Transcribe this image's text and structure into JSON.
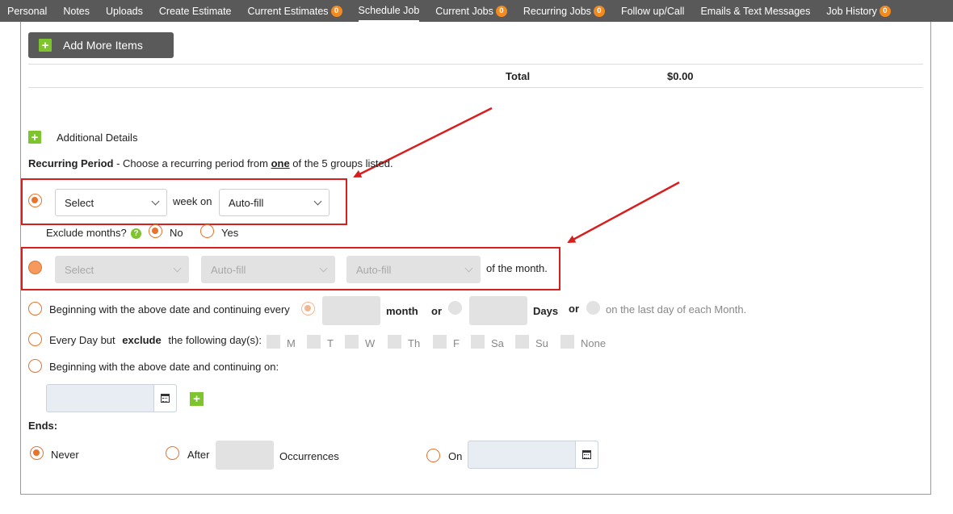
{
  "nav": {
    "tabs": [
      {
        "label": "Personal"
      },
      {
        "label": "Notes"
      },
      {
        "label": "Uploads"
      },
      {
        "label": "Create Estimate"
      },
      {
        "label": "Current Estimates",
        "count": "0"
      },
      {
        "label": "Schedule Job"
      },
      {
        "label": "Current Jobs",
        "count": "0"
      },
      {
        "label": "Recurring Jobs",
        "count": "0"
      },
      {
        "label": "Follow up/Call"
      },
      {
        "label": "Emails & Text Messages"
      },
      {
        "label": "Job History",
        "count": "0"
      }
    ],
    "active_tab": "Schedule Job"
  },
  "items": {
    "add_more_label": "Add More Items",
    "total_label": "Total",
    "total_value": "$0.00"
  },
  "additional_details_label": "Additional Details",
  "recurring": {
    "title": "Recurring Period",
    "desc_before": " - Choose a recurring period from ",
    "desc_emph": "one",
    "desc_after": " of the 5 groups listed.",
    "weekly": {
      "select_value": "Select",
      "week_on_label": "week on",
      "day_value": "Auto-fill"
    },
    "exclude_months": {
      "label": "Exclude months?",
      "no_label": "No",
      "yes_label": "Yes"
    },
    "monthly": {
      "select_value": "Select",
      "fill1_value": "Auto-fill",
      "fill2_value": "Auto-fill",
      "suffix": "of the month."
    },
    "continuing_every": {
      "label": "Beginning with the above date and continuing every",
      "month_label": "month",
      "or1": "or",
      "days_label": "Days",
      "or2": "or",
      "last_day_label": "on the last day of each Month."
    },
    "every_day": {
      "label_before": "Every Day but",
      "label_emph": "exclude",
      "label_after": "the following day(s):",
      "days": [
        "M",
        "T",
        "W",
        "Th",
        "F",
        "Sa",
        "Su",
        "None"
      ]
    },
    "continuing_on": {
      "label": "Beginning with the above date and continuing on:"
    }
  },
  "ends": {
    "label": "Ends:",
    "never_label": "Never",
    "after_label": "After",
    "occurrences_label": "Occurrences",
    "on_label": "On"
  },
  "colors": {
    "nav_bg": "#595959",
    "accent_orange": "#e8732c",
    "badge_orange": "#f28a1f",
    "plus_green": "#7dc42d",
    "annotation_red": "#d81e1e"
  }
}
